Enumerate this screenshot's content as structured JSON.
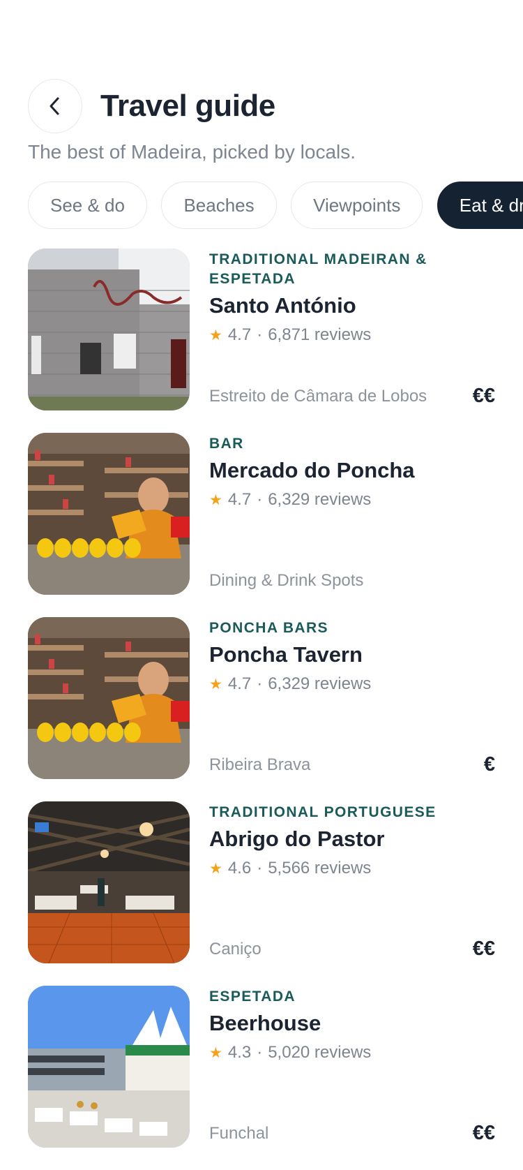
{
  "header": {
    "title": "Travel guide",
    "subtitle": "The best of Madeira, picked by locals."
  },
  "filters": {
    "chips": [
      {
        "label": "See & do",
        "active": false
      },
      {
        "label": "Beaches",
        "active": false
      },
      {
        "label": "Viewpoints",
        "active": false
      },
      {
        "label": "Eat & drink",
        "active": true
      }
    ]
  },
  "places": [
    {
      "category": "TRADITIONAL MADEIRAN & ESPETADA",
      "name": "Santo António",
      "rating": "4.7",
      "reviews": "6,871 reviews",
      "location": "Estreito de Câmara de Lobos",
      "price": "€€"
    },
    {
      "category": "BAR",
      "name": "Mercado do Poncha",
      "rating": "4.7",
      "reviews": "6,329 reviews",
      "location": "Dining & Drink Spots",
      "price": ""
    },
    {
      "category": "PONCHA BARS",
      "name": "Poncha Tavern",
      "rating": "4.7",
      "reviews": "6,329 reviews",
      "location": "Ribeira Brava",
      "price": "€"
    },
    {
      "category": "TRADITIONAL PORTUGUESE",
      "name": "Abrigo do Pastor",
      "rating": "4.6",
      "reviews": "5,566 reviews",
      "location": "Caniço",
      "price": "€€"
    },
    {
      "category": "ESPETADA",
      "name": "Beerhouse",
      "rating": "4.3",
      "reviews": "5,020 reviews",
      "location": "Funchal",
      "price": "€€"
    }
  ],
  "icons": {
    "back": "chevron-left-icon",
    "star": "star-icon"
  },
  "colors": {
    "accent": "#1a5b5a",
    "active_chip": "#152232",
    "star": "#f2a31b"
  }
}
